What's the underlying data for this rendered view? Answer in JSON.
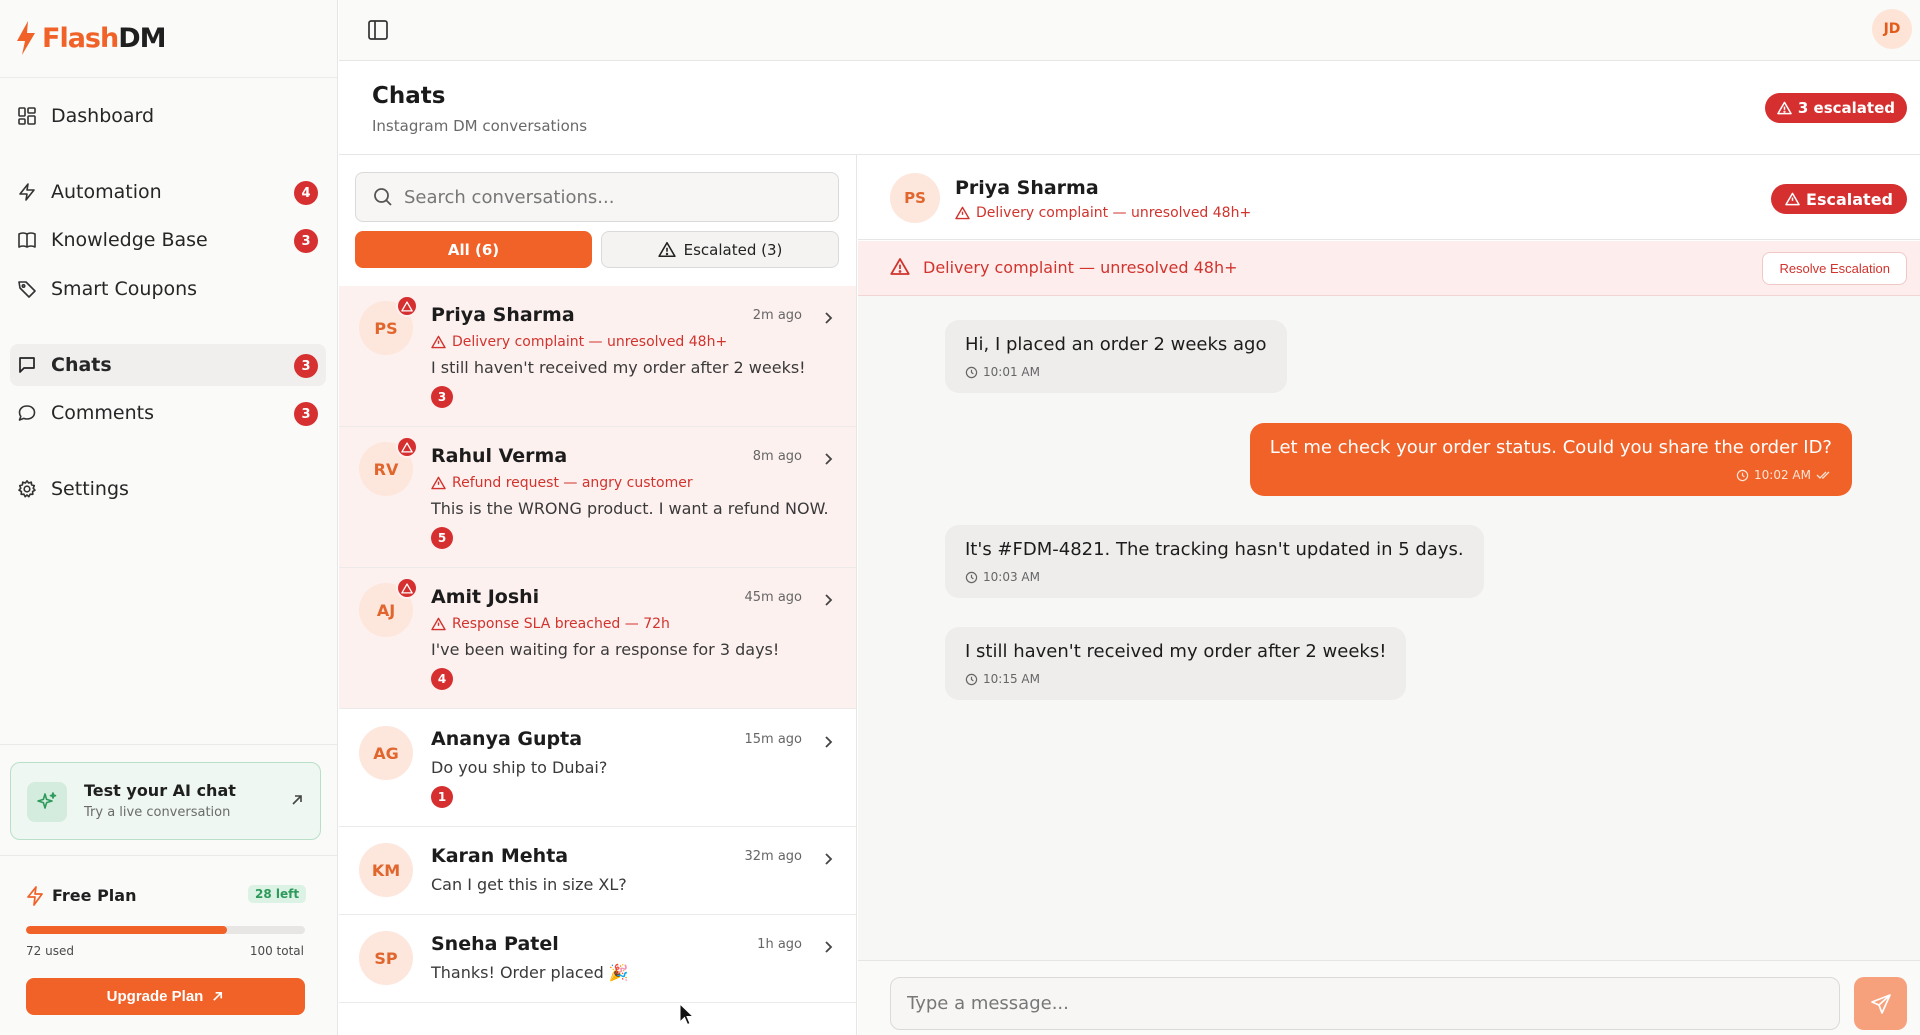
{
  "brand": {
    "name_part1": "Flash",
    "name_part2": "DM"
  },
  "colors": {
    "accent": "#f06228",
    "danger": "#d62f30",
    "success": "#2d9a5b"
  },
  "nav": {
    "items": [
      {
        "label": "Dashboard",
        "icon": "dashboard-grid-icon"
      },
      {
        "label": "Automation",
        "icon": "bolt-icon",
        "badge": "4"
      },
      {
        "label": "Knowledge Base",
        "icon": "book-icon",
        "badge": "3"
      },
      {
        "label": "Smart Coupons",
        "icon": "tag-icon"
      },
      {
        "label": "Chats",
        "icon": "chat-square-icon",
        "badge": "3",
        "active": true
      },
      {
        "label": "Comments",
        "icon": "chat-bubble-icon",
        "badge": "3"
      },
      {
        "label": "Settings",
        "icon": "gear-icon"
      }
    ]
  },
  "test_chat": {
    "title": "Test your AI chat",
    "subtitle": "Try a live conversation"
  },
  "plan": {
    "name": "Free Plan",
    "left_label": "28 left",
    "used_label": "72 used",
    "total_label": "100 total",
    "used_fraction": 0.72,
    "upgrade_label": "Upgrade Plan"
  },
  "user": {
    "initials": "JD"
  },
  "page": {
    "title": "Chats",
    "subtitle": "Instagram DM conversations",
    "escalated_label": "3 escalated"
  },
  "search": {
    "placeholder": "Search conversations..."
  },
  "filters": {
    "all_label": "All (6)",
    "escalated_label": "Escalated (3)"
  },
  "conversations": [
    {
      "initials": "PS",
      "name": "Priya Sharma",
      "time": "2m ago",
      "reason": "Delivery complaint — unresolved 48h+",
      "message": "I still haven't received my order after 2 weeks!",
      "count": "3",
      "escalated": true
    },
    {
      "initials": "RV",
      "name": "Rahul Verma",
      "time": "8m ago",
      "reason": "Refund request — angry customer",
      "message": "This is the WRONG product. I want a refund NOW.",
      "count": "5",
      "escalated": true
    },
    {
      "initials": "AJ",
      "name": "Amit Joshi",
      "time": "45m ago",
      "reason": "Response SLA breached — 72h",
      "message": "I've been waiting for a response for 3 days!",
      "count": "4",
      "escalated": true
    },
    {
      "initials": "AG",
      "name": "Ananya Gupta",
      "time": "15m ago",
      "message": "Do you ship to Dubai?",
      "count": "1",
      "escalated": false
    },
    {
      "initials": "KM",
      "name": "Karan Mehta",
      "time": "32m ago",
      "message": "Can I get this in size XL?",
      "escalated": false
    },
    {
      "initials": "SP",
      "name": "Sneha Patel",
      "time": "1h ago",
      "message": "Thanks! Order placed 🎉",
      "escalated": false
    }
  ],
  "chat": {
    "initials": "PS",
    "name": "Priya Sharma",
    "reason": "Delivery complaint — unresolved 48h+",
    "badge": "Escalated",
    "banner_text": "Delivery complaint — unresolved 48h+",
    "resolve_label": "Resolve Escalation",
    "messages": [
      {
        "direction": "in",
        "text": "Hi, I placed an order 2 weeks ago",
        "time": "10:01 AM"
      },
      {
        "direction": "out",
        "text": "Let me check your order status. Could you share the order ID?",
        "time": "10:02 AM"
      },
      {
        "direction": "in",
        "text": "It's #FDM-4821. The tracking hasn't updated in 5 days.",
        "time": "10:03 AM"
      },
      {
        "direction": "in",
        "text": "I still haven't received my order after 2 weeks!",
        "time": "10:15 AM"
      }
    ],
    "composer_placeholder": "Type a message..."
  }
}
